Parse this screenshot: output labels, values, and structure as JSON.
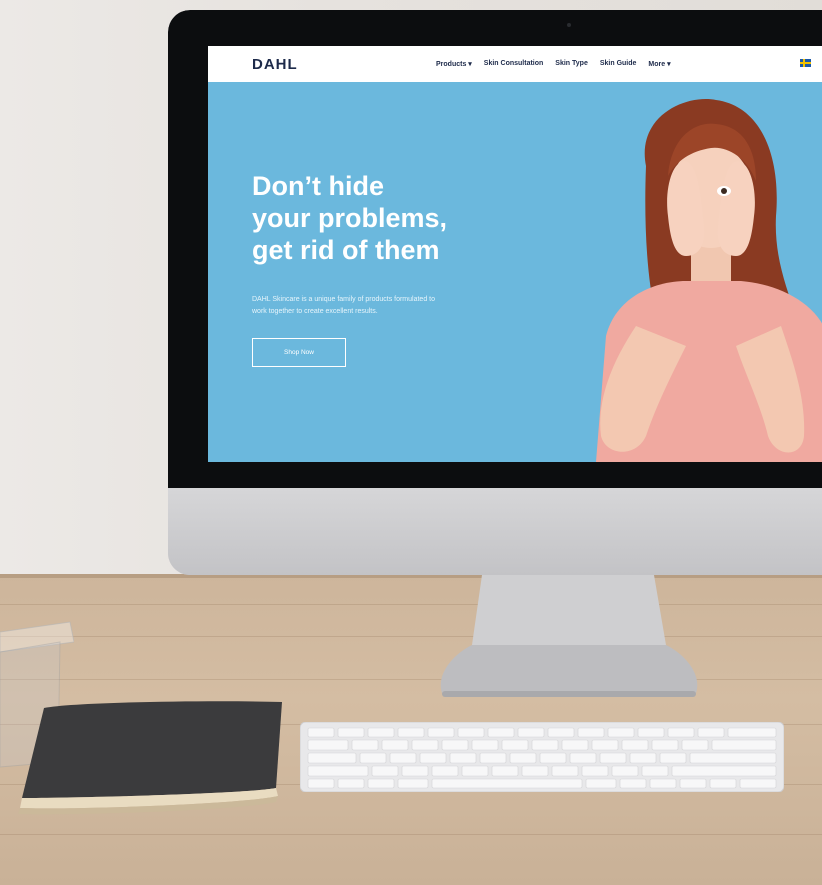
{
  "site": {
    "logo": "DAHL",
    "nav": [
      {
        "label": "Products ▾"
      },
      {
        "label": "Skin Consultation"
      },
      {
        "label": "Skin Type"
      },
      {
        "label": "Skin Guide"
      },
      {
        "label": "More ▾"
      }
    ],
    "flag_icon": "sweden-flag-icon"
  },
  "hero": {
    "headline_lines": [
      "Don’t hide",
      "your problems,",
      "get rid of them"
    ],
    "subtitle_line1": "DAHL Skincare is a unique family of products formulated to",
    "subtitle_line2": "work together to create excellent results.",
    "cta": "Shop Now",
    "background_color": "#6bb8dd"
  }
}
